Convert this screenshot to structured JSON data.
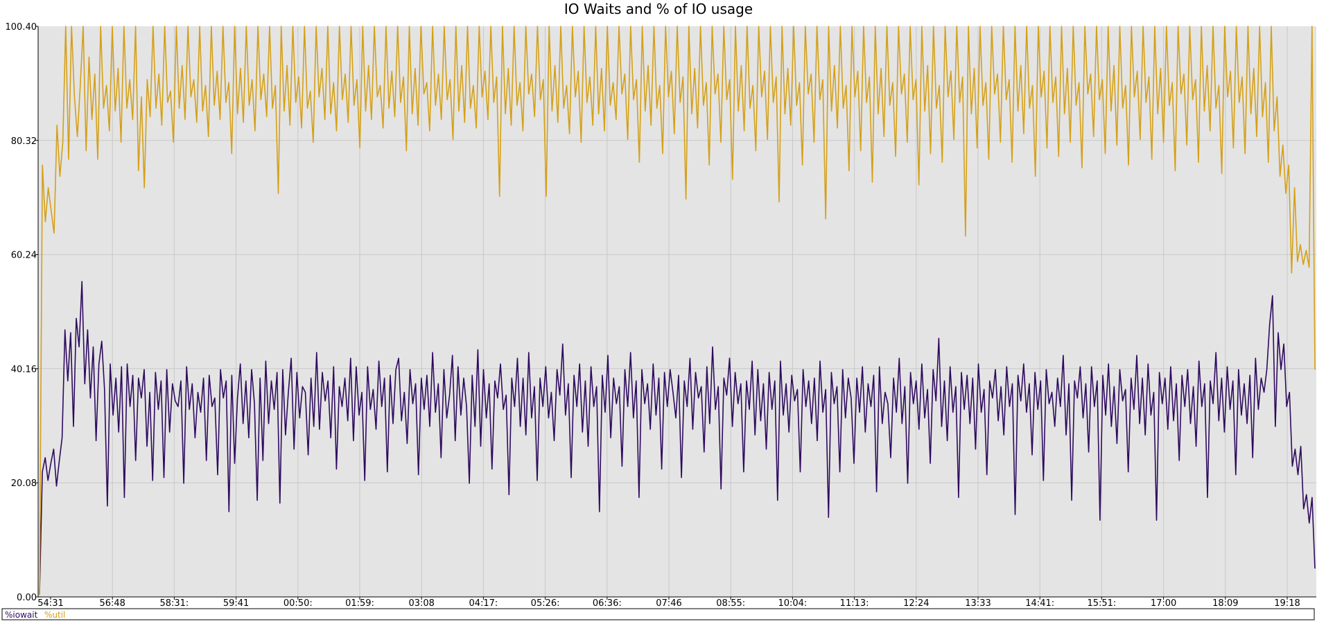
{
  "chart_data": {
    "type": "line",
    "title": "IO Waits and % of IO usage",
    "xlabel": "",
    "ylabel": "",
    "ylim": [
      0,
      100.4
    ],
    "y_ticks": [
      "0.00",
      "20.08",
      "40.16",
      "60.24",
      "80.32",
      "100.40"
    ],
    "x_ticks": [
      "54:31",
      "56:48",
      "58:31:",
      "59:41",
      "00:50:",
      "01:59:",
      "03:08",
      "04:17:",
      "05:26:",
      "06:36:",
      "07:46",
      "08:55:",
      "10:04:",
      "11:13:",
      "12:24",
      "13:33",
      "14:41:",
      "15:51:",
      "17:00",
      "18:09",
      "19:18"
    ],
    "grid": true,
    "legend_position": "bottom-left",
    "colors": {
      "iowait": "#2e0a5e",
      "util": "#d4a017",
      "plot_background": "#e4e4e4",
      "grid": "#c8c8c8"
    },
    "series": [
      {
        "name": "%iowait",
        "color": "#2e0a5e",
        "values": [
          0.5,
          22.0,
          24.5,
          20.5,
          23.5,
          26.0,
          19.5,
          24.0,
          28.0,
          47.0,
          38.0,
          46.5,
          30.0,
          49.0,
          44.0,
          55.5,
          37.5,
          47.0,
          35.0,
          44.0,
          27.5,
          41.0,
          45.0,
          36.5,
          16.0,
          41.0,
          32.0,
          38.5,
          29.0,
          40.5,
          17.5,
          41.0,
          33.5,
          39.0,
          24.0,
          38.5,
          35.0,
          40.0,
          26.5,
          36.0,
          20.5,
          39.5,
          33.0,
          38.0,
          21.0,
          40.0,
          29.0,
          37.5,
          34.5,
          33.5,
          38.0,
          20.0,
          40.5,
          33.0,
          37.5,
          28.0,
          36.0,
          32.5,
          38.5,
          24.0,
          39.0,
          33.5,
          35.0,
          21.5,
          40.0,
          35.0,
          38.0,
          15.0,
          39.0,
          23.5,
          35.0,
          41.0,
          30.5,
          38.0,
          28.0,
          40.0,
          34.0,
          17.0,
          38.5,
          24.0,
          41.5,
          30.5,
          38.0,
          33.0,
          39.5,
          16.5,
          40.0,
          28.5,
          36.0,
          42.0,
          26.0,
          39.5,
          31.5,
          37.0,
          36.0,
          25.0,
          38.5,
          30.0,
          43.0,
          29.5,
          39.5,
          34.5,
          38.0,
          28.0,
          40.5,
          22.5,
          37.0,
          33.5,
          38.5,
          31.0,
          42.0,
          27.5,
          40.5,
          32.0,
          36.0,
          20.5,
          40.5,
          33.0,
          36.5,
          29.5,
          41.5,
          33.5,
          38.5,
          22.0,
          39.0,
          30.5,
          40.0,
          42.0,
          31.0,
          36.0,
          27.0,
          40.0,
          34.0,
          37.5,
          21.5,
          38.5,
          33.0,
          39.0,
          30.0,
          43.0,
          32.5,
          37.5,
          24.5,
          40.0,
          31.5,
          35.5,
          42.5,
          27.5,
          40.5,
          32.0,
          38.5,
          33.5,
          20.0,
          39.0,
          30.0,
          43.5,
          26.5,
          40.0,
          31.5,
          37.5,
          22.5,
          38.0,
          35.0,
          41.0,
          33.0,
          35.5,
          18.0,
          38.5,
          33.5,
          42.0,
          30.0,
          38.5,
          28.5,
          43.0,
          31.5,
          37.0,
          20.5,
          38.5,
          33.5,
          40.5,
          31.5,
          36.0,
          27.5,
          40.0,
          35.5,
          44.5,
          32.0,
          37.5,
          21.0,
          39.0,
          33.5,
          41.0,
          29.0,
          38.0,
          26.5,
          40.5,
          33.5,
          37.0,
          15.0,
          39.0,
          32.5,
          42.5,
          28.0,
          38.5,
          34.0,
          37.0,
          23.0,
          40.0,
          33.5,
          43.0,
          31.5,
          38.0,
          17.5,
          40.0,
          34.0,
          37.5,
          29.5,
          41.0,
          32.0,
          38.5,
          22.5,
          39.5,
          33.5,
          40.0,
          36.0,
          31.5,
          39.0,
          21.0,
          38.0,
          33.5,
          42.0,
          29.5,
          39.5,
          35.0,
          37.0,
          25.5,
          40.5,
          30.5,
          44.0,
          33.0,
          37.0,
          19.0,
          38.5,
          35.5,
          42.0,
          30.0,
          39.5,
          34.0,
          37.5,
          22.0,
          38.0,
          33.0,
          41.5,
          28.5,
          40.0,
          31.0,
          37.5,
          26.0,
          39.5,
          33.0,
          38.0,
          17.0,
          41.5,
          32.0,
          37.5,
          29.0,
          39.0,
          34.5,
          36.5,
          22.0,
          40.0,
          33.5,
          38.0,
          30.5,
          38.5,
          27.5,
          41.5,
          32.5,
          36.5,
          14.0,
          39.5,
          34.0,
          37.0,
          22.0,
          40.0,
          31.5,
          38.5,
          35.0,
          23.5,
          38.5,
          32.5,
          40.5,
          29.0,
          37.5,
          33.5,
          39.0,
          18.5,
          40.5,
          30.5,
          36.0,
          34.0,
          24.5,
          38.5,
          32.5,
          42.0,
          30.5,
          37.0,
          20.0,
          39.5,
          34.0,
          38.0,
          29.5,
          41.0,
          31.5,
          36.5,
          23.5,
          40.0,
          34.5,
          45.5,
          30.0,
          38.0,
          27.5,
          40.5,
          32.5,
          37.0,
          17.5,
          39.5,
          33.0,
          39.0,
          30.5,
          38.5,
          26.0,
          41.0,
          32.5,
          36.5,
          21.5,
          38.0,
          35.0,
          40.0,
          31.0,
          37.0,
          28.5,
          40.5,
          33.5,
          37.5,
          14.5,
          39.0,
          34.5,
          41.0,
          32.5,
          37.5,
          25.0,
          39.5,
          33.0,
          38.0,
          20.5,
          40.0,
          34.0,
          36.0,
          30.0,
          38.5,
          33.5,
          42.5,
          28.5,
          37.5,
          17.0,
          38.0,
          35.0,
          40.5,
          31.5,
          37.5,
          25.5,
          40.5,
          33.5,
          38.0,
          13.5,
          39.0,
          32.0,
          41.0,
          30.0,
          37.0,
          27.0,
          40.0,
          34.5,
          36.5,
          22.0,
          38.5,
          33.0,
          42.5,
          30.5,
          38.5,
          28.5,
          41.0,
          32.0,
          36.0,
          13.5,
          39.5,
          34.0,
          38.5,
          29.5,
          40.5,
          31.0,
          37.5,
          24.0,
          39.0,
          33.5,
          40.0,
          30.5,
          37.0,
          26.5,
          41.5,
          33.5,
          37.5,
          17.5,
          38.0,
          34.0,
          43.0,
          31.0,
          38.5,
          29.0,
          40.5,
          33.0,
          38.0,
          21.5,
          40.0,
          32.0,
          37.5,
          30.5,
          39.0,
          24.5,
          42.0,
          33.0,
          38.5,
          36.0,
          40.0,
          48.0,
          53.0,
          30.0,
          46.5,
          40.0,
          44.5,
          33.5,
          36.0,
          23.0,
          26.0,
          21.5,
          26.5,
          15.5,
          18.0,
          13.0,
          17.5,
          5.0
        ]
      },
      {
        "name": "%util",
        "color": "#d4a017",
        "values": [
          0.3,
          76.0,
          66.0,
          72.0,
          68.0,
          64.0,
          83.0,
          74.0,
          80.0,
          100.4,
          77.0,
          100.4,
          88.0,
          81.0,
          90.0,
          100.4,
          78.5,
          95.0,
          84.0,
          92.0,
          77.0,
          100.4,
          86.0,
          90.0,
          82.0,
          100.4,
          85.5,
          93.0,
          80.0,
          100.4,
          86.0,
          91.0,
          84.0,
          100.4,
          75.0,
          88.0,
          72.0,
          91.0,
          84.5,
          100.4,
          86.0,
          92.0,
          83.0,
          100.4,
          87.0,
          89.0,
          80.0,
          100.4,
          86.0,
          93.5,
          84.0,
          100.4,
          88.0,
          91.0,
          83.5,
          100.4,
          85.5,
          90.0,
          81.0,
          100.4,
          86.5,
          92.5,
          84.0,
          100.4,
          87.0,
          90.5,
          78.0,
          100.4,
          85.0,
          93.0,
          83.5,
          100.4,
          86.5,
          91.0,
          82.0,
          100.4,
          87.5,
          92.0,
          84.5,
          100.4,
          86.0,
          90.0,
          71.0,
          100.4,
          85.5,
          93.5,
          83.0,
          100.4,
          87.0,
          91.5,
          82.5,
          100.4,
          86.0,
          89.0,
          80.0,
          100.4,
          88.0,
          93.0,
          84.0,
          100.4,
          85.0,
          90.5,
          82.0,
          100.4,
          87.5,
          92.0,
          83.5,
          100.4,
          86.5,
          91.0,
          79.0,
          100.4,
          85.5,
          93.5,
          84.0,
          100.4,
          88.0,
          90.0,
          82.5,
          100.4,
          86.0,
          92.5,
          84.5,
          100.4,
          87.0,
          91.5,
          78.5,
          100.4,
          85.0,
          93.0,
          83.0,
          100.4,
          88.5,
          90.5,
          82.0,
          100.4,
          86.5,
          92.0,
          84.0,
          100.4,
          87.5,
          91.0,
          80.5,
          100.4,
          85.5,
          93.5,
          83.5,
          100.4,
          86.0,
          90.0,
          82.5,
          100.4,
          88.0,
          92.5,
          84.0,
          100.4,
          87.0,
          91.5,
          70.5,
          100.4,
          85.0,
          93.0,
          83.0,
          100.4,
          86.5,
          90.5,
          82.0,
          100.4,
          88.5,
          92.0,
          84.5,
          100.4,
          87.5,
          91.0,
          70.5,
          100.4,
          85.5,
          93.5,
          83.5,
          100.4,
          86.0,
          90.0,
          81.5,
          100.4,
          88.0,
          92.5,
          80.0,
          100.4,
          87.0,
          91.5,
          83.0,
          100.4,
          85.0,
          93.0,
          82.0,
          100.4,
          86.5,
          90.5,
          84.0,
          100.4,
          88.5,
          92.0,
          80.5,
          100.4,
          87.5,
          91.0,
          76.5,
          100.4,
          85.5,
          93.5,
          83.0,
          100.4,
          86.0,
          90.0,
          78.0,
          100.4,
          88.0,
          92.5,
          81.5,
          100.4,
          87.0,
          91.5,
          70.0,
          100.4,
          85.0,
          93.0,
          82.5,
          100.4,
          86.5,
          90.5,
          76.0,
          100.4,
          88.5,
          92.0,
          80.0,
          100.4,
          87.5,
          91.0,
          73.5,
          100.4,
          85.5,
          93.5,
          82.0,
          100.4,
          86.0,
          90.0,
          78.5,
          100.4,
          88.0,
          92.5,
          80.5,
          100.4,
          87.0,
          91.5,
          69.5,
          100.4,
          85.0,
          93.0,
          83.0,
          100.4,
          86.5,
          90.5,
          76.0,
          100.4,
          88.5,
          92.0,
          80.0,
          100.4,
          87.5,
          91.0,
          66.5,
          100.4,
          85.5,
          93.5,
          82.5,
          100.4,
          86.0,
          90.0,
          75.0,
          100.4,
          88.0,
          92.5,
          78.5,
          100.4,
          87.0,
          91.5,
          73.0,
          100.4,
          85.0,
          93.0,
          81.0,
          100.4,
          86.5,
          90.5,
          77.5,
          100.4,
          88.5,
          92.0,
          80.0,
          100.4,
          87.5,
          91.0,
          72.5,
          100.4,
          85.5,
          93.5,
          78.0,
          100.4,
          86.0,
          90.0,
          76.5,
          100.4,
          88.0,
          92.5,
          80.5,
          100.4,
          87.0,
          91.5,
          63.5,
          100.4,
          85.0,
          93.0,
          79.0,
          100.4,
          86.5,
          90.5,
          77.0,
          100.4,
          88.5,
          92.0,
          80.0,
          100.4,
          87.5,
          91.0,
          76.5,
          100.4,
          85.5,
          93.5,
          81.5,
          100.4,
          86.0,
          90.0,
          74.0,
          100.4,
          88.0,
          92.5,
          79.0,
          100.4,
          87.0,
          91.5,
          77.5,
          100.4,
          85.0,
          93.0,
          80.0,
          100.4,
          86.5,
          90.5,
          75.5,
          100.4,
          88.5,
          92.0,
          81.0,
          100.4,
          87.5,
          91.0,
          78.0,
          100.4,
          85.5,
          93.5,
          79.5,
          100.4,
          86.0,
          90.0,
          76.0,
          100.4,
          88.0,
          92.5,
          80.5,
          100.4,
          87.0,
          91.5,
          77.0,
          100.4,
          85.0,
          93.0,
          80.0,
          100.4,
          86.5,
          90.5,
          75.0,
          100.4,
          88.5,
          92.0,
          79.5,
          100.4,
          87.5,
          91.0,
          76.5,
          100.4,
          85.5,
          93.5,
          82.0,
          100.4,
          86.0,
          90.0,
          74.5,
          100.4,
          88.0,
          92.5,
          79.0,
          100.4,
          87.0,
          91.5,
          78.0,
          100.4,
          85.0,
          93.0,
          81.0,
          100.4,
          84.5,
          90.5,
          76.5,
          100.4,
          82.0,
          88.0,
          74.0,
          79.5,
          71.0,
          76.0,
          57.0,
          72.0,
          59.0,
          62.0,
          58.5,
          61.0,
          58.0,
          100.4,
          40.0
        ]
      }
    ]
  }
}
